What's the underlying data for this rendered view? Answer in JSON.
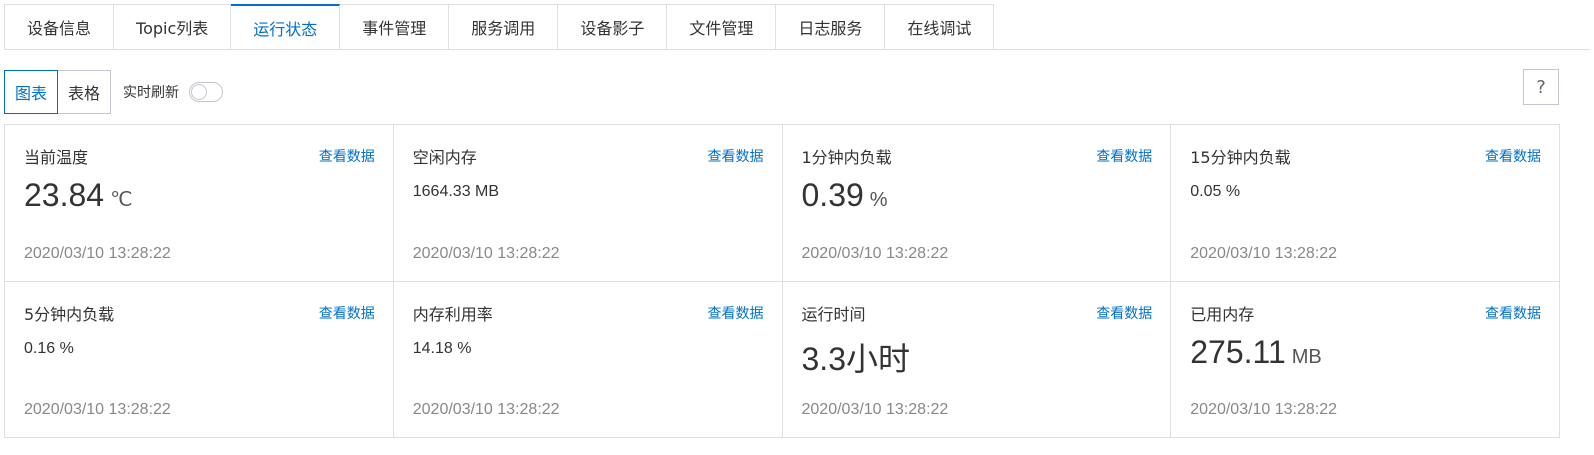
{
  "tabs": [
    "设备信息",
    "Topic列表",
    "运行状态",
    "事件管理",
    "服务调用",
    "设备影子",
    "文件管理",
    "日志服务",
    "在线调试"
  ],
  "active_tab": "运行状态",
  "toolbar": {
    "view_chart": "图表",
    "view_table": "表格",
    "refresh_label": "实时刷新",
    "refresh_on": false,
    "help": "?"
  },
  "cards": [
    {
      "title": "当前温度",
      "link": "查看数据",
      "value": "23.84",
      "unit": "℃",
      "big": true,
      "time": "2020/03/10 13:28:22"
    },
    {
      "title": "空闲内存",
      "link": "查看数据",
      "value": "1664.33 MB",
      "unit": "",
      "big": false,
      "time": "2020/03/10 13:28:22"
    },
    {
      "title": "1分钟内负载",
      "link": "查看数据",
      "value": "0.39",
      "unit": "%",
      "big": true,
      "time": "2020/03/10 13:28:22"
    },
    {
      "title": "15分钟内负载",
      "link": "查看数据",
      "value": "0.05 %",
      "unit": "",
      "big": false,
      "time": "2020/03/10 13:28:22"
    },
    {
      "title": "5分钟内负载",
      "link": "查看数据",
      "value": "0.16 %",
      "unit": "",
      "big": false,
      "time": "2020/03/10 13:28:22"
    },
    {
      "title": "内存利用率",
      "link": "查看数据",
      "value": "14.18 %",
      "unit": "",
      "big": false,
      "time": "2020/03/10 13:28:22"
    },
    {
      "title": "运行时间",
      "link": "查看数据",
      "value": "3.3小时",
      "unit": "",
      "big": true,
      "time": "2020/03/10 13:28:22"
    },
    {
      "title": "已用内存",
      "link": "查看数据",
      "value": "275.11",
      "unit": "MB",
      "big": true,
      "time": "2020/03/10 13:28:22"
    }
  ],
  "colors": {
    "accent": "#0070cc",
    "border": "#dcdfe3",
    "muted": "#888888"
  }
}
